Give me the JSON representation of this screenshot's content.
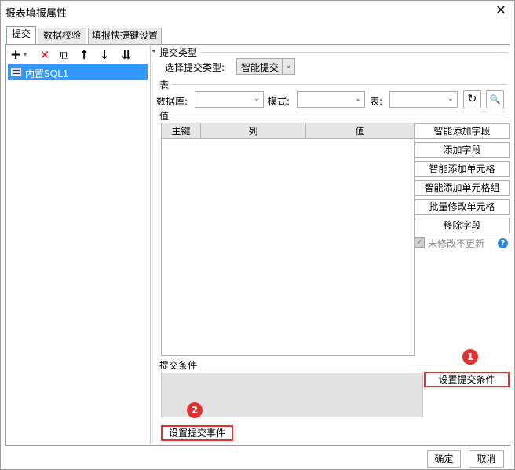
{
  "window": {
    "title": "报表填报属性",
    "close_glyph": "✕"
  },
  "tabs": [
    {
      "label": "提交"
    },
    {
      "label": "数据校验"
    },
    {
      "label": "填报快捷键设置"
    }
  ],
  "left": {
    "toolbar": {
      "add": "+",
      "add_dropdown": "▾",
      "delete": "✕",
      "copy": "⧉",
      "up": "↑",
      "down": "↓",
      "sort": "⇊"
    },
    "tree_items": [
      {
        "label": "内置SQL1"
      }
    ],
    "collapse_arrow": "◂"
  },
  "submit_type": {
    "section_title": "提交类型",
    "label": "选择提交类型:",
    "value": "智能提交",
    "arrow": "⌄"
  },
  "table_section": {
    "section_title": "表",
    "database_label": "数据库:",
    "database_value": "",
    "schema_label": "模式:",
    "schema_value": "",
    "table_label": "表:",
    "table_value": "",
    "arrow": "⌄",
    "refresh_glyph": "↻",
    "preview_glyph": "🔍"
  },
  "values_section": {
    "section_title": "值",
    "columns": [
      "主键",
      "列",
      "值"
    ],
    "buttons": [
      "智能添加字段",
      "添加字段",
      "智能添加单元格",
      "智能添加单元格组",
      "批量修改单元格",
      "移除字段"
    ],
    "checkbox_label": "未修改不更新",
    "checkbox_mark": "✓",
    "help_glyph": "?"
  },
  "condition_section": {
    "section_title": "提交条件",
    "set_condition_button": "设置提交条件",
    "set_event_button": "设置提交事件"
  },
  "badges": [
    "1",
    "2"
  ],
  "footer": {
    "ok": "确定",
    "cancel": "取消"
  },
  "colors": {
    "selection": "#3399ff",
    "highlight_border": "#e03030",
    "badge": "#e03131",
    "help": "#2f8ad8"
  }
}
